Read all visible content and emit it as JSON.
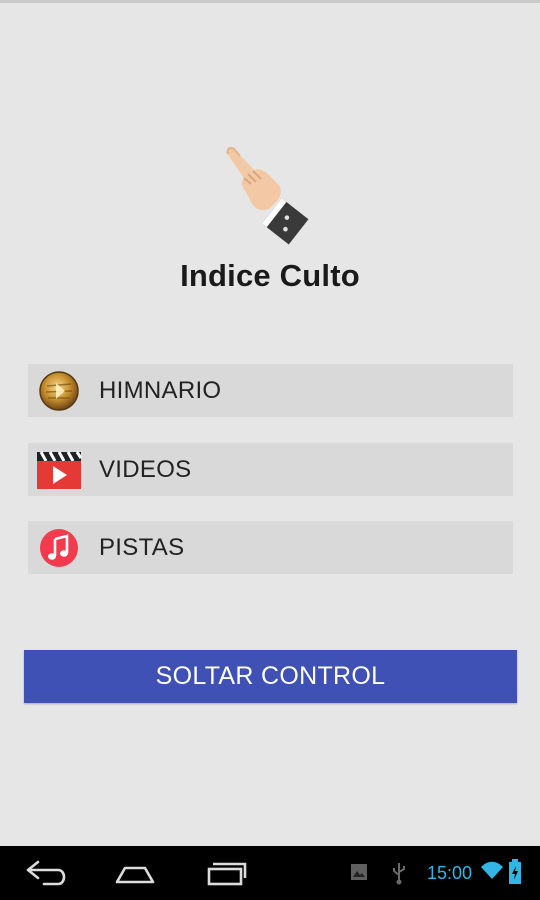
{
  "header": {
    "title": "Indice Culto"
  },
  "menu": {
    "items": [
      {
        "label": "HIMNARIO",
        "icon": "hymnal-disc-icon"
      },
      {
        "label": "VIDEOS",
        "icon": "video-clapper-icon"
      },
      {
        "label": "PISTAS",
        "icon": "music-note-icon"
      }
    ]
  },
  "actions": {
    "release_label": "SOLTAR CONTROL"
  },
  "status_bar": {
    "time": "15:00"
  },
  "colors": {
    "background": "#e6e6e6",
    "item_background": "#d9d9d9",
    "primary_button": "#3f51b5",
    "status_accent": "#33b5e5",
    "video_red": "#e53935",
    "music_red": "#f23b4f"
  }
}
